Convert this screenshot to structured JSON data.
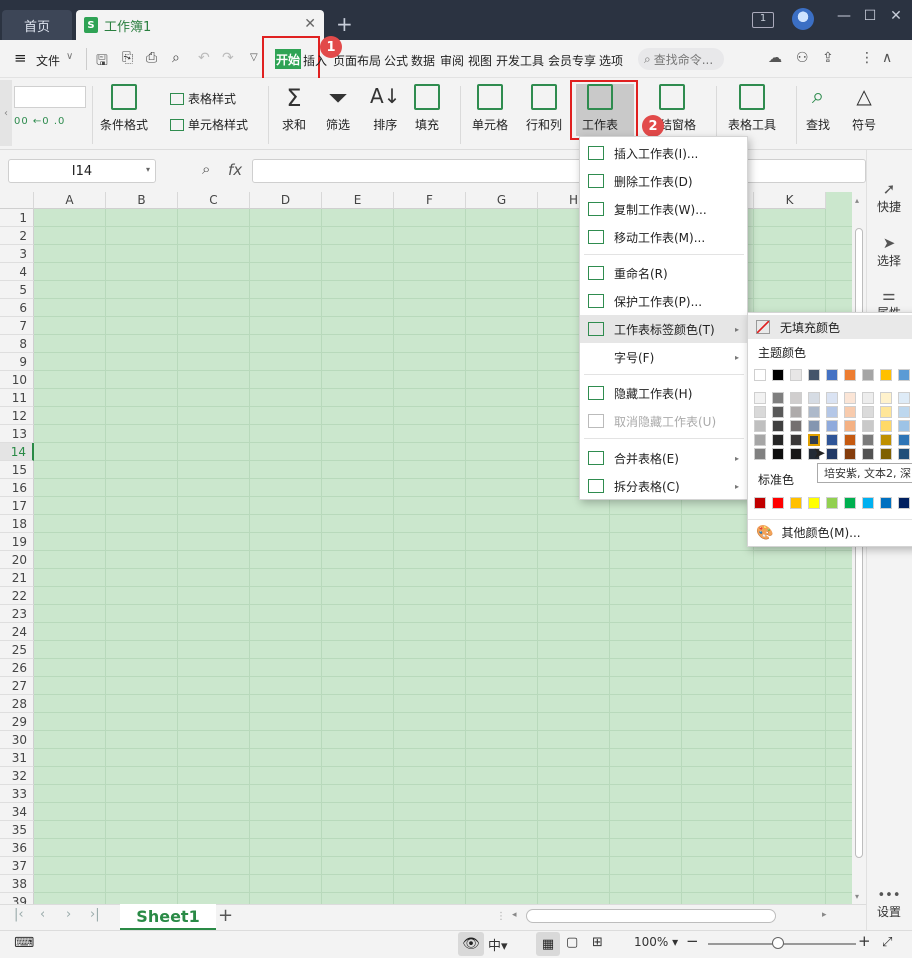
{
  "tabs": {
    "home": "首页",
    "doc": "工作簿1"
  },
  "menubar": {
    "file": "文件",
    "items": [
      "开始",
      "插入",
      "页面布局",
      "公式",
      "数据",
      "审阅",
      "视图",
      "开发工具",
      "会员专享",
      "选项"
    ],
    "search_placeholder": "查找命令..."
  },
  "ribbon": {
    "cond_format": "条件格式",
    "table_style": "表格样式",
    "cell_style": "单元格样式",
    "sum": "求和",
    "filter": "筛选",
    "sort": "排序",
    "fill": "填充",
    "cell": "单元格",
    "rowcol": "行和列",
    "worksheet": "工作表",
    "freeze": "冻结窗格",
    "table_tools": "表格工具",
    "find": "查找",
    "symbol": "符号"
  },
  "formula": {
    "name_box": "I14",
    "fx": "fx"
  },
  "columns": [
    "A",
    "B",
    "C",
    "D",
    "E",
    "F",
    "G",
    "H",
    "I",
    "J",
    "K"
  ],
  "rows": [
    "1",
    "2",
    "3",
    "4",
    "5",
    "6",
    "7",
    "8",
    "9",
    "10",
    "11",
    "12",
    "13",
    "14",
    "15",
    "16",
    "17",
    "18",
    "19",
    "20",
    "21",
    "22",
    "23",
    "24",
    "25",
    "26",
    "27",
    "28",
    "29",
    "30",
    "31",
    "32",
    "33",
    "34",
    "35",
    "36",
    "37",
    "38",
    "39"
  ],
  "selected_row": "14",
  "dropdown": {
    "items": [
      {
        "label": "插入工作表(I)...",
        "disabled": false
      },
      {
        "label": "删除工作表(D)",
        "disabled": false
      },
      {
        "label": "复制工作表(W)...",
        "disabled": false
      },
      {
        "label": "移动工作表(M)...",
        "disabled": false
      },
      {
        "label": "重命名(R)",
        "disabled": false
      },
      {
        "label": "保护工作表(P)...",
        "disabled": false
      },
      {
        "label": "工作表标签颜色(T)",
        "disabled": false,
        "submenu": true,
        "highlight": true
      },
      {
        "label": "字号(F)",
        "disabled": false,
        "submenu": true
      },
      {
        "label": "隐藏工作表(H)",
        "disabled": false
      },
      {
        "label": "取消隐藏工作表(U)",
        "disabled": true
      },
      {
        "label": "合并表格(E)",
        "disabled": false,
        "submenu": true
      },
      {
        "label": "拆分表格(C)",
        "disabled": false,
        "submenu": true
      }
    ]
  },
  "colors": {
    "no_fill": "无填充颜色",
    "theme": "主题颜色",
    "standard": "标准色",
    "more": "其他颜色(M)...",
    "tooltip": "培安紫, 文本2, 深",
    "theme_top": [
      "#ffffff",
      "#000000",
      "#e7e6e6",
      "#44546a",
      "#4472c4",
      "#ed7d31",
      "#a5a5a5",
      "#ffc000",
      "#5b9bd5"
    ],
    "theme_cols": [
      [
        "#f2f2f2",
        "#d9d9d9",
        "#bfbfbf",
        "#a6a6a6",
        "#808080"
      ],
      [
        "#7f7f7f",
        "#595959",
        "#3f3f3f",
        "#262626",
        "#0d0d0d"
      ],
      [
        "#d0cece",
        "#aeabab",
        "#757171",
        "#3a3838",
        "#171616"
      ],
      [
        "#d6dce4",
        "#adb9ca",
        "#8496b0",
        "#333f50",
        "#222a35"
      ],
      [
        "#dae3f3",
        "#b4c7e7",
        "#8faadc",
        "#2f5597",
        "#203864"
      ],
      [
        "#fbe5d6",
        "#f8cbad",
        "#f4b183",
        "#c55a11",
        "#843c0c"
      ],
      [
        "#ededed",
        "#dbdbdb",
        "#c9c9c9",
        "#7b7b7b",
        "#525252"
      ],
      [
        "#fff2cc",
        "#ffe699",
        "#ffd966",
        "#bf9000",
        "#7f6000"
      ],
      [
        "#deebf7",
        "#bdd7ee",
        "#9dc3e6",
        "#2e75b6",
        "#1f4e79"
      ]
    ],
    "standard_colors": [
      "#c00000",
      "#ff0000",
      "#ffc000",
      "#ffff00",
      "#92d050",
      "#00b050",
      "#00b0f0",
      "#0070c0",
      "#002060"
    ]
  },
  "side_panel": [
    "快捷",
    "选择",
    "属性",
    "设置"
  ],
  "sheet_tab": "Sheet1",
  "status": {
    "zoom": "100%"
  },
  "badges": [
    "1",
    "2"
  ]
}
